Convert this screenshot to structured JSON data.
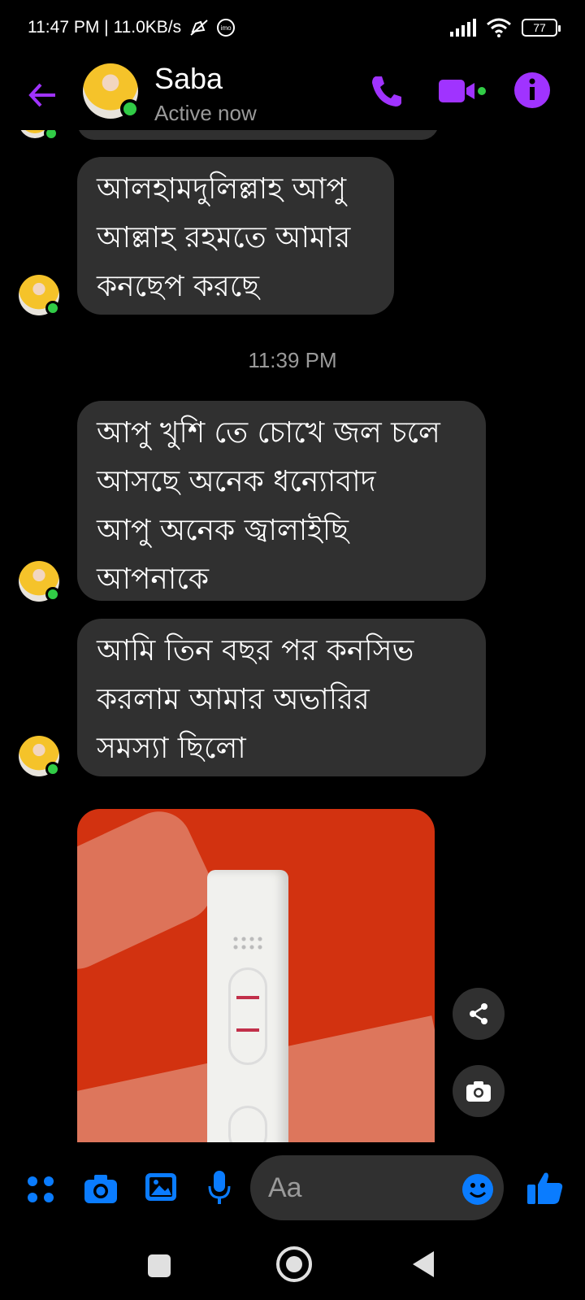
{
  "status_bar": {
    "time_speed": "11:47 PM | 11.0KB/s",
    "imo_label": "imo",
    "battery": "77"
  },
  "header": {
    "contact_name": "Saba",
    "contact_status": "Active now",
    "accent_color": "#a033ff"
  },
  "messages": [
    {
      "text_lines": [
        "আলহামদুলিল্লাহ আপু",
        "আল্লাহ রহমতে আমার",
        "কনছেপ করছে"
      ]
    },
    {
      "timestamp": "11:39 PM"
    },
    {
      "text_lines": [
        "আপু খুশি তে চোখে জল চলে",
        "আসছে অনেক ধন্যোবাদ",
        "আপু অনেক জ্বালাইছি",
        "আপনাকে"
      ]
    },
    {
      "text_lines": [
        "আমি তিন বছর পর কনসিভ",
        "করলাম আমার অভারির",
        "সমস্যা ছিলো"
      ]
    }
  ],
  "photo_actions": {
    "share_icon": "share-icon",
    "camera_icon": "camera-icon"
  },
  "composer": {
    "placeholder": "Aa",
    "accent_color": "#0a7cff",
    "icons": [
      "apps-icon",
      "camera-icon",
      "gallery-icon",
      "mic-icon",
      "emoji-icon",
      "thumbs-up-icon"
    ]
  }
}
